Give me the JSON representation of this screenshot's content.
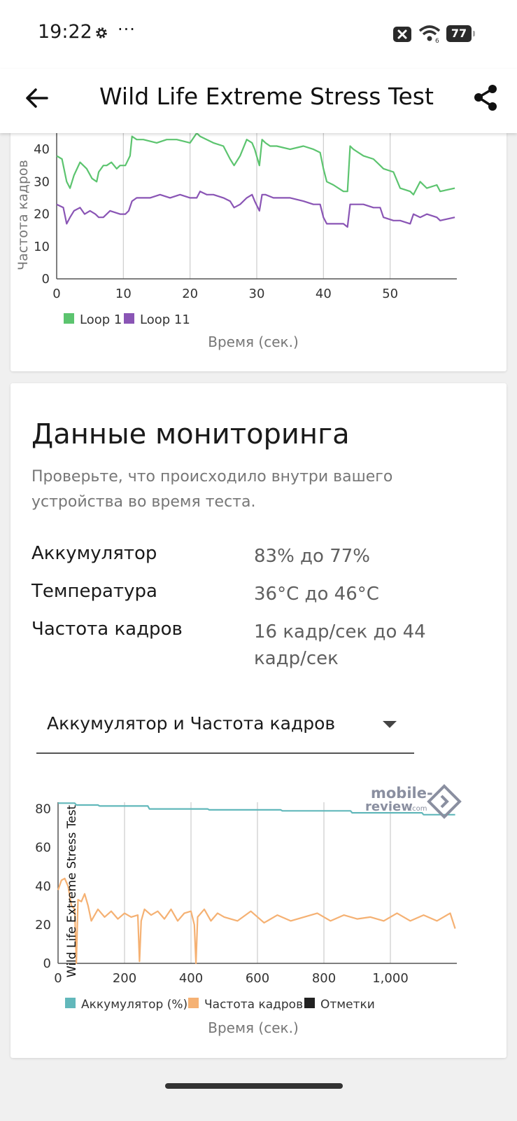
{
  "status_bar": {
    "time": "19:22",
    "more": "···",
    "battery": "77",
    "icons": [
      "gear-icon",
      "close-icon",
      "wifi-icon",
      "battery-icon"
    ]
  },
  "app_bar": {
    "title": "Wild Life Extreme Stress Test",
    "back_icon": "arrow-left-icon",
    "share_icon": "share-icon"
  },
  "fps_chart": {
    "ylabel": "Частота кадров",
    "xlabel": "Время (сек.)",
    "legend": [
      "Loop 1",
      "Loop 11"
    ]
  },
  "monitoring": {
    "title": "Данные мониторинга",
    "description": "Проверьте, что происходило внутри вашего устройства во время теста.",
    "rows": [
      {
        "label": "Аккумулятор",
        "value": "83% до 77%"
      },
      {
        "label": "Температура",
        "value": "36°C до 46°C"
      },
      {
        "label": "Частота кадров",
        "value": "16 кадр/сек до 44 кадр/сек"
      }
    ],
    "dropdown": {
      "value": "Аккумулятор и Частота кадров"
    }
  },
  "monitor_chart": {
    "ylabel": "Wild Life Extreme Stress Test",
    "xlabel": "Время (сек.)",
    "legend": [
      "Аккумулятор (%)",
      "Частота кадров",
      "Отметки"
    ]
  },
  "watermark": {
    "line1": "mobile-",
    "line2": "review",
    "suffix": ".com"
  },
  "colors": {
    "loop1": "#5cc46f",
    "loop11": "#8a55b5",
    "battery": "#62b8bb",
    "framerate": "#f5b173",
    "marks": "#222222"
  },
  "chart_data": [
    {
      "type": "line",
      "title": "",
      "xlabel": "Время (сек.)",
      "ylabel": "Частота кадров",
      "xlim": [
        0,
        60
      ],
      "ylim": [
        0,
        45
      ],
      "xticks": [
        0,
        10,
        20,
        30,
        40,
        50
      ],
      "yticks": [
        0,
        10,
        20,
        30,
        40
      ],
      "grid": "vertical",
      "legend": "bottom-left",
      "series": [
        {
          "name": "Loop 1",
          "x": [
            0,
            0.8,
            1.5,
            2,
            2.6,
            3.5,
            4.5,
            5.3,
            6,
            6.3,
            7,
            7.5,
            8.2,
            9,
            9.5,
            10.3,
            11,
            11.3,
            12,
            13,
            15,
            16.5,
            18,
            20,
            21,
            21.5,
            22.5,
            23.5,
            25,
            26,
            26.6,
            27.5,
            28.5,
            29.3,
            29.7,
            30.4,
            30.8,
            31.3,
            32,
            33,
            35,
            37,
            38.5,
            39.5,
            40,
            40.5,
            41.5,
            43,
            43.6,
            44,
            44.5,
            46,
            47.5,
            48.5,
            49,
            50.5,
            51.5,
            53,
            53.5,
            54.5,
            55.5,
            57,
            57.5,
            59.7
          ],
          "y": [
            38,
            37,
            30,
            28,
            32,
            36,
            34,
            31,
            30,
            33,
            35,
            35,
            36,
            34,
            35,
            35,
            38,
            44,
            43,
            43,
            42,
            43,
            43,
            42,
            45,
            44,
            43,
            42,
            41,
            37,
            35,
            38,
            43,
            42,
            40,
            35,
            43,
            42,
            41,
            41,
            40,
            41,
            40,
            39,
            34,
            30,
            29,
            27,
            27,
            41,
            40,
            38,
            37,
            35,
            34,
            33,
            28,
            27,
            26,
            30,
            28,
            29,
            27,
            28
          ]
        },
        {
          "name": "Loop 11",
          "x": [
            0,
            1,
            1.5,
            2,
            2.6,
            3.5,
            4.2,
            5,
            5.8,
            6.3,
            7,
            8,
            9.5,
            10.3,
            10.8,
            11.3,
            12,
            13,
            14,
            15.5,
            17,
            18.5,
            20,
            21,
            21.5,
            22.5,
            23.5,
            25,
            26,
            26.6,
            27.5,
            28.5,
            29.3,
            29.7,
            30.4,
            30.8,
            31.3,
            32.5,
            35,
            37,
            38.5,
            39.5,
            40,
            40.5,
            41.5,
            43,
            43.6,
            44,
            44.5,
            46,
            47.5,
            48.5,
            49,
            50.5,
            51.5,
            53,
            53.5,
            54.5,
            55.5,
            57,
            57.5,
            59.7
          ],
          "y": [
            23,
            22,
            17,
            19,
            21,
            22,
            20,
            21,
            20,
            19,
            19,
            21,
            20,
            20,
            21,
            24,
            25,
            25,
            25,
            26,
            25,
            26,
            25,
            25,
            27,
            26,
            26,
            25,
            24,
            22,
            23,
            25,
            26,
            24,
            21,
            26,
            26,
            25,
            25,
            24,
            23,
            23,
            19,
            17,
            17,
            17,
            16,
            23,
            23,
            23,
            22,
            22,
            19,
            18,
            18,
            17,
            20,
            19,
            20,
            19,
            18,
            19
          ]
        }
      ]
    },
    {
      "type": "line",
      "title": "",
      "xlabel": "Время (сек.)",
      "ylabel": "Wild Life Extreme Stress Test",
      "xlim": [
        0,
        1200
      ],
      "ylim": [
        0,
        90
      ],
      "xticks": [
        0,
        200,
        400,
        600,
        800,
        1000
      ],
      "xtick_labels": [
        "0",
        "200",
        "400",
        "600",
        "800",
        "1,000"
      ],
      "yticks": [
        0,
        20,
        40,
        60,
        80
      ],
      "grid": "vertical",
      "legend": "bottom-left",
      "series": [
        {
          "name": "Аккумулятор (%)",
          "x": [
            0,
            50,
            55,
            120,
            125,
            270,
            275,
            450,
            455,
            670,
            675,
            880,
            885,
            1095,
            1100,
            1195
          ],
          "y": [
            83,
            83,
            82,
            82,
            81.5,
            81.5,
            80,
            80,
            79.5,
            79.5,
            79,
            79,
            78,
            78,
            77,
            77
          ]
        },
        {
          "name": "Частота кадров",
          "x": [
            0,
            10,
            20,
            30,
            40,
            50,
            55,
            60,
            70,
            80,
            90,
            100,
            120,
            140,
            160,
            180,
            200,
            220,
            240,
            245,
            250,
            260,
            280,
            300,
            320,
            340,
            360,
            380,
            400,
            410,
            415,
            420,
            440,
            460,
            480,
            500,
            540,
            580,
            620,
            660,
            700,
            740,
            780,
            820,
            860,
            900,
            940,
            980,
            1020,
            1060,
            1100,
            1140,
            1180,
            1195
          ],
          "y": [
            38,
            43,
            44,
            40,
            30,
            28,
            0,
            33,
            32,
            36,
            30,
            22,
            28,
            24,
            27,
            23,
            26,
            24,
            25,
            1,
            22,
            28,
            25,
            27,
            23,
            28,
            22,
            26,
            27,
            20,
            0,
            24,
            28,
            22,
            26,
            24,
            22,
            27,
            21,
            25,
            22,
            24,
            26,
            22,
            25,
            23,
            24,
            22,
            26,
            22,
            25,
            22,
            26,
            18
          ]
        },
        {
          "name": "Отметки",
          "x": [],
          "y": []
        }
      ]
    }
  ]
}
